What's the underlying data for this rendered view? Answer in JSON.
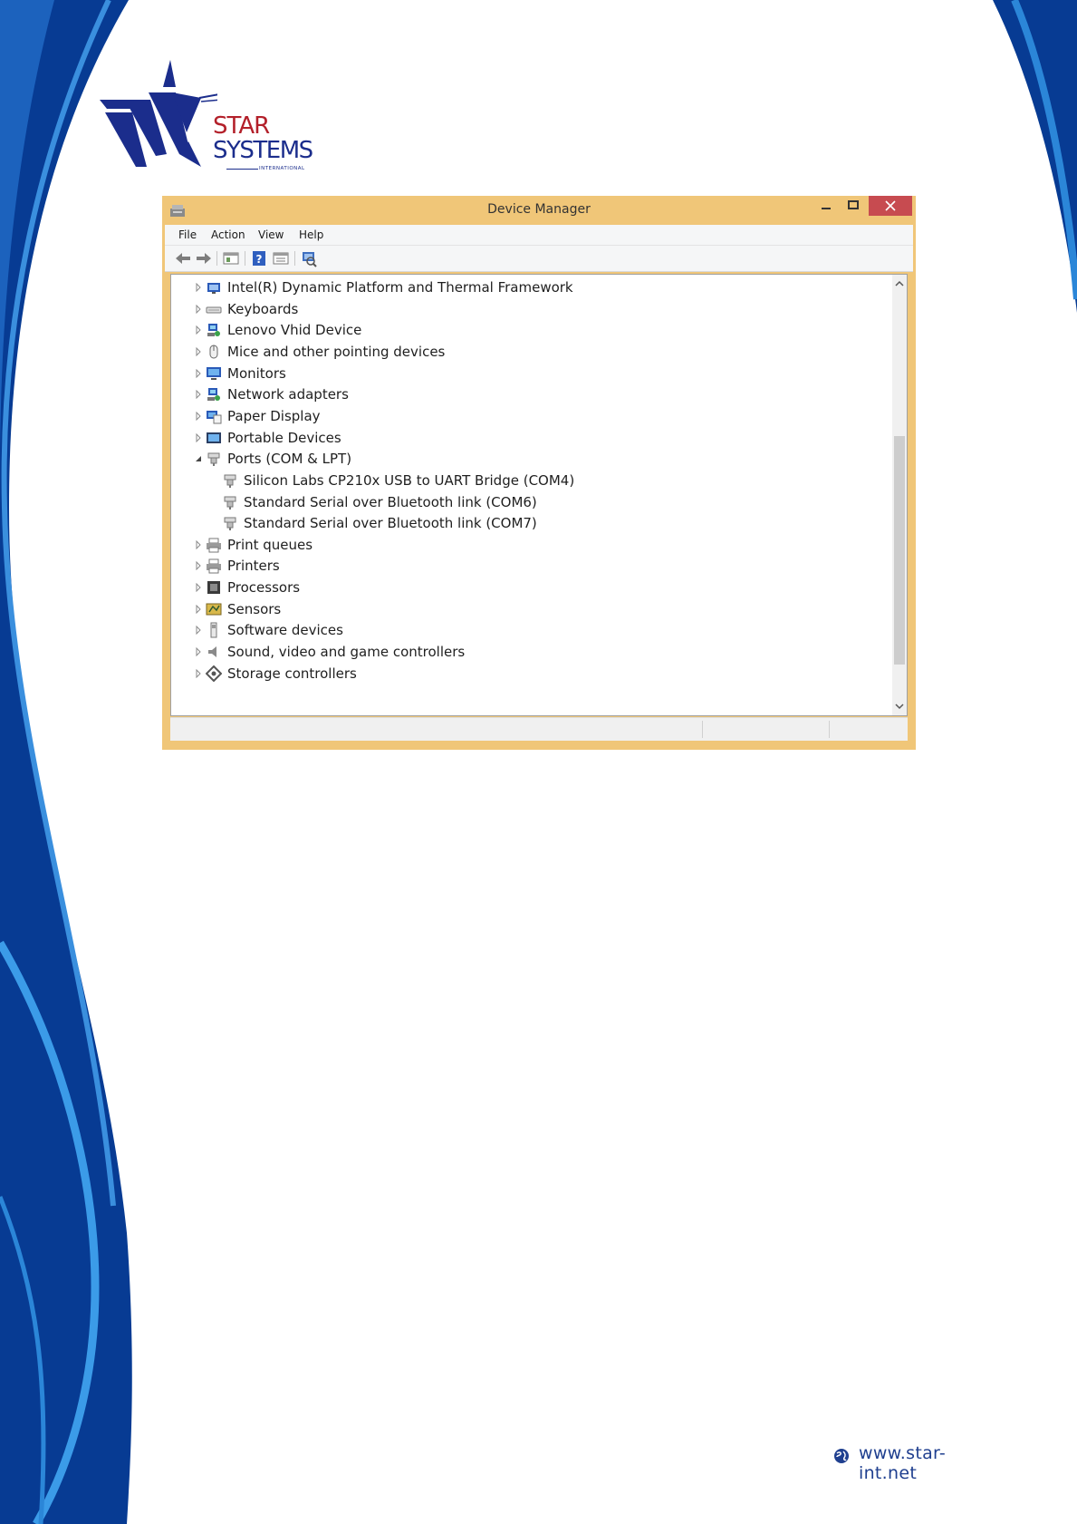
{
  "brand": {
    "name_line1": "STAR",
    "name_line2": "SYSTEMS",
    "name_line3": "INTERNATIONAL",
    "colors": {
      "blue": "#1b2d8c",
      "red": "#b3202a"
    }
  },
  "window": {
    "title": "Device Manager",
    "accent": "#f0c678",
    "close_color": "#c74b50",
    "controls": {
      "minimize": "minimize-icon",
      "maximize": "maximize-icon",
      "close": "close-icon"
    },
    "menu": [
      "File",
      "Action",
      "View",
      "Help"
    ],
    "toolbar": [
      "back-icon",
      "forward-icon",
      "show-hide-tree-icon",
      "help-icon",
      "properties-icon",
      "scan-hardware-icon"
    ],
    "tree": [
      {
        "label": "Intel(R) Dynamic Platform and Thermal Framework",
        "icon": "intel-icon",
        "expanded": false
      },
      {
        "label": "Keyboards",
        "icon": "keyboard-icon",
        "expanded": false
      },
      {
        "label": "Lenovo Vhid Device",
        "icon": "network-device-icon",
        "expanded": false
      },
      {
        "label": "Mice and other pointing devices",
        "icon": "mouse-icon",
        "expanded": false
      },
      {
        "label": "Monitors",
        "icon": "monitor-icon",
        "expanded": false
      },
      {
        "label": "Network adapters",
        "icon": "network-adapter-icon",
        "expanded": false
      },
      {
        "label": "Paper Display",
        "icon": "paper-display-icon",
        "expanded": false
      },
      {
        "label": "Portable Devices",
        "icon": "portable-device-icon",
        "expanded": false
      },
      {
        "label": "Ports (COM & LPT)",
        "icon": "port-icon",
        "expanded": true
      },
      {
        "label": "Silicon Labs CP210x USB to UART Bridge (COM4)",
        "icon": "port-icon",
        "child": true
      },
      {
        "label": "Standard Serial over Bluetooth link (COM6)",
        "icon": "port-icon",
        "child": true
      },
      {
        "label": "Standard Serial over Bluetooth link (COM7)",
        "icon": "port-icon",
        "child": true
      },
      {
        "label": "Print queues",
        "icon": "printer-icon",
        "expanded": false
      },
      {
        "label": "Printers",
        "icon": "printer-icon",
        "expanded": false
      },
      {
        "label": "Processors",
        "icon": "processor-icon",
        "expanded": false
      },
      {
        "label": "Sensors",
        "icon": "sensor-icon",
        "expanded": false
      },
      {
        "label": "Software devices",
        "icon": "software-device-icon",
        "expanded": false
      },
      {
        "label": "Sound, video and game controllers",
        "icon": "speaker-icon",
        "expanded": false
      },
      {
        "label": "Storage controllers",
        "icon": "storage-controller-icon",
        "expanded": false
      }
    ]
  },
  "footer": {
    "website": "www.star-int.net",
    "icon": "globe-icon"
  }
}
